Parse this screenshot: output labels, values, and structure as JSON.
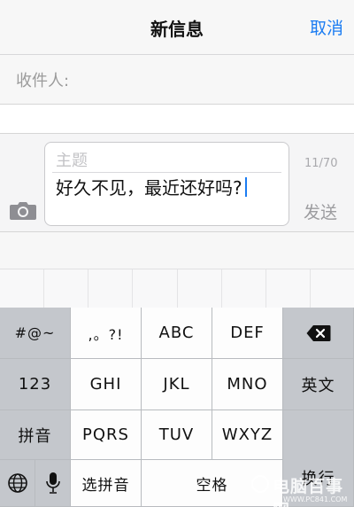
{
  "navbar": {
    "title": "新信息",
    "cancel": "取消"
  },
  "recipient": {
    "label": "收件人:"
  },
  "compose": {
    "subject_placeholder": "主题",
    "body_text": "好久不见，最近还好吗?",
    "char_count": "11/70",
    "send": "发送"
  },
  "keyboard": {
    "symbols": "#@~",
    "punct": ",。?!",
    "abc": "ABC",
    "def": "DEF",
    "digits": "123",
    "ghi": "GHI",
    "jkl": "JKL",
    "mno": "MNO",
    "english": "英文",
    "pinyin": "拼音",
    "pqrs": "PQRS",
    "tuv": "TUV",
    "wxyz": "WXYZ",
    "enter": "换行",
    "select_pinyin": "选拼音",
    "space": "空格"
  },
  "watermark": {
    "text": "电脑百事网",
    "sub": "WWW.PC841.COM"
  },
  "colors": {
    "accent": "#1b7cf2",
    "keyboard_bg": "#cfd2d6",
    "key_gray": "#c4c7cc",
    "key_white": "#fdfdfd"
  }
}
